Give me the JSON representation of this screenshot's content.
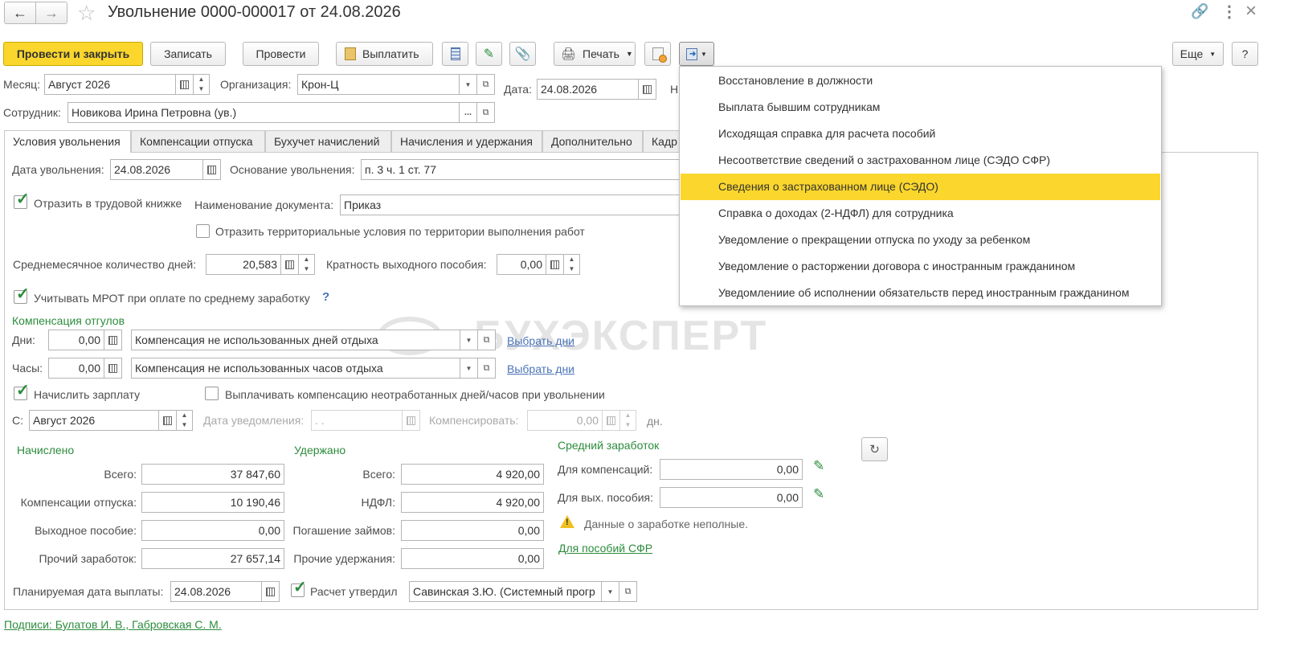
{
  "window": {
    "title": "Увольнение 0000-000017 от 24.08.2026"
  },
  "toolbar": {
    "post_close": "Провести и закрыть",
    "save": "Записать",
    "post": "Провести",
    "pay": "Выплатить",
    "print": "Печать",
    "more": "Еще",
    "help": "?"
  },
  "header": {
    "month_label": "Месяц:",
    "month_value": "Август 2026",
    "org_label": "Организация:",
    "org_value": "Крон-Ц",
    "date_label": "Дата:",
    "date_value": "24.08.2026",
    "number_label_partial": "Н",
    "employee_label": "Сотрудник:",
    "employee_value": "Новикова Ирина Петровна (ув.)"
  },
  "tabs": [
    "Условия увольнения",
    "Компенсации отпуска",
    "Бухучет начислений",
    "Начисления и удержания",
    "Дополнительно",
    "Кадр"
  ],
  "conditions": {
    "dismissal_date_label": "Дата увольнения:",
    "dismissal_date": "24.08.2026",
    "basis_label": "Основание увольнения:",
    "basis_value": "п. 3 ч. 1 ст. 77",
    "workbook_label": "Отразить в трудовой книжке",
    "doc_name_label": "Наименование документа:",
    "doc_name_value": "Приказ",
    "territorial_label": "Отразить территориальные условия по территории выполнения работ",
    "avg_days_label": "Среднемесячное количество дней:",
    "avg_days_value": "20,583",
    "severance_mult_label": "Кратность выходного пособия:",
    "severance_mult_value": "0,00",
    "mrot_label": "Учитывать МРОТ при оплате по среднему заработку",
    "mrot_help": "?",
    "comp_section": "Компенсация отгулов",
    "days_label": "Дни:",
    "days_value": "0,00",
    "days_type": "Компенсация не использованных дней отдыха",
    "days_link": "Выбрать дни",
    "hours_label": "Часы:",
    "hours_value": "0,00",
    "hours_type": "Компенсация не использованных часов отдыха",
    "hours_link": "Выбрать дни",
    "accrue_salary_label": "Начислить зарплату",
    "pay_comp_label": "Выплачивать компенсацию неотработанных дней/часов при увольнении",
    "from_label": "С:",
    "from_value": "Август 2026",
    "notice_date_label": "Дата уведомления:",
    "notice_date_value": " .  .",
    "compensate_label": "Компенсировать:",
    "compensate_value": "0,00",
    "compensate_unit": "дн."
  },
  "accrued": {
    "title": "Начислено",
    "total_label": "Всего:",
    "total": "37 847,60",
    "vacation_label": "Компенсации отпуска:",
    "vacation": "10 190,46",
    "severance_label": "Выходное пособие:",
    "severance": "0,00",
    "other_label": "Прочий заработок:",
    "other": "27 657,14"
  },
  "withheld": {
    "title": "Удержано",
    "total_label": "Всего:",
    "total": "4 920,00",
    "ndfl_label": "НДФЛ:",
    "ndfl": "4 920,00",
    "loans_label": "Погашение займов:",
    "loans": "0,00",
    "other_label": "Прочие удержания:",
    "other": "0,00"
  },
  "avg_earnings": {
    "title": "Средний заработок",
    "comp_label": "Для компенсаций:",
    "comp_value": "0,00",
    "sev_label": "Для вых. пособия:",
    "sev_value": "0,00",
    "warning": "Данные о заработке неполные.",
    "sfr_link": "Для пособий СФР"
  },
  "footer": {
    "pay_date_label": "Планируемая дата выплаты:",
    "pay_date": "24.08.2026",
    "approved_label": "Расчет утвердил",
    "approved_by": "Савинская З.Ю. (Системный прогр",
    "signatures": "Подписи: Булатов И. В., Габровская С. М."
  },
  "watermark": "БУХЭКСПЕРТ",
  "dropdown_menu": {
    "items": [
      "Восстановление в должности",
      "Выплата бывшим сотрудникам",
      "Исходящая справка для расчета пособий",
      "Несоответствие сведений о застрахованном лице (СЭДО СФР)",
      "Сведения о застрахованном лице (СЭДО)",
      "Справка о доходах (2-НДФЛ) для сотрудника",
      "Уведомление о прекращении отпуска по уходу за ребенком",
      "Уведомление о расторжении договора с иностранным гражданином",
      "Уведомлениие об исполнении обязательств перед иностранным гражданином"
    ],
    "selected_index": 4
  },
  "colors": {
    "accent": "#fbd62c",
    "green": "#2c8c3c",
    "link": "#4a73b8"
  }
}
